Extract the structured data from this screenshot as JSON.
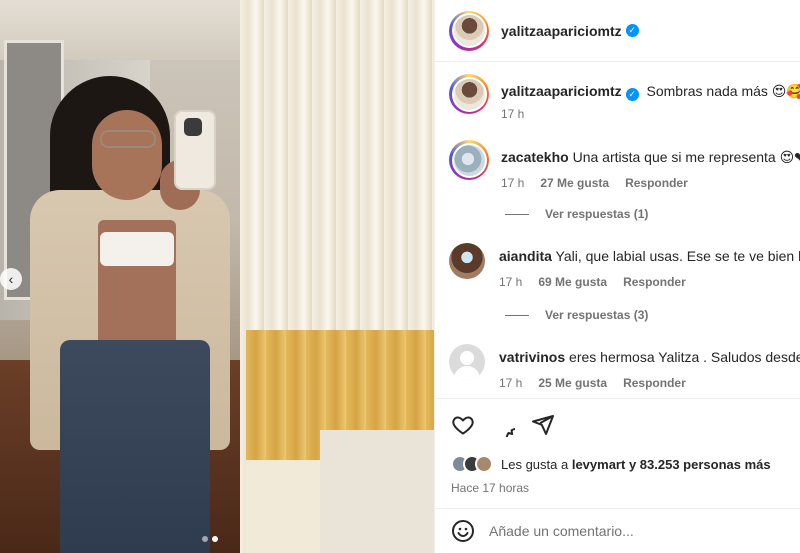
{
  "photo": {
    "nav_prev_glyph": "‹",
    "carousel_dots": 2,
    "carousel_active_index": 1
  },
  "post_header": {
    "username": "yalitzaapariciomtz",
    "verified": true
  },
  "caption": {
    "username": "yalitzaapariciomtz",
    "text": "Sombras nada más 😍🥰",
    "time": "17 h"
  },
  "comments": [
    {
      "username": "zacatekho",
      "text": "Una artista que si me representa 😍❤",
      "time": "17 h",
      "likes": "27 Me gusta",
      "reply": "Responder",
      "view_replies": "Ver respuestas (1)"
    },
    {
      "username": "aiandita",
      "text": "Yali, que labial usas. Ese se te ve bien bo",
      "time": "17 h",
      "likes": "69 Me gusta",
      "reply": "Responder",
      "view_replies": "Ver respuestas (3)"
    },
    {
      "username": "vatrivinos",
      "text": "eres hermosa Yalitza . Saludos desde C",
      "time": "17 h",
      "likes": "25 Me gusta",
      "reply": "Responder"
    }
  ],
  "actions": {
    "like_icon": "heart-icon",
    "comment_icon": "comment-icon",
    "share_icon": "send-icon",
    "likes_prefix": "Les gusta a",
    "likes_user": "levymart",
    "likes_suffix": "y 83.253 personas más",
    "posted_ago": "Hace 17 horas"
  },
  "add_comment": {
    "emoji_icon": "smiley-icon",
    "placeholder": "Añade un comentario..."
  },
  "colors": {
    "verified_blue": "#0095f6",
    "muted_text": "#737373"
  }
}
